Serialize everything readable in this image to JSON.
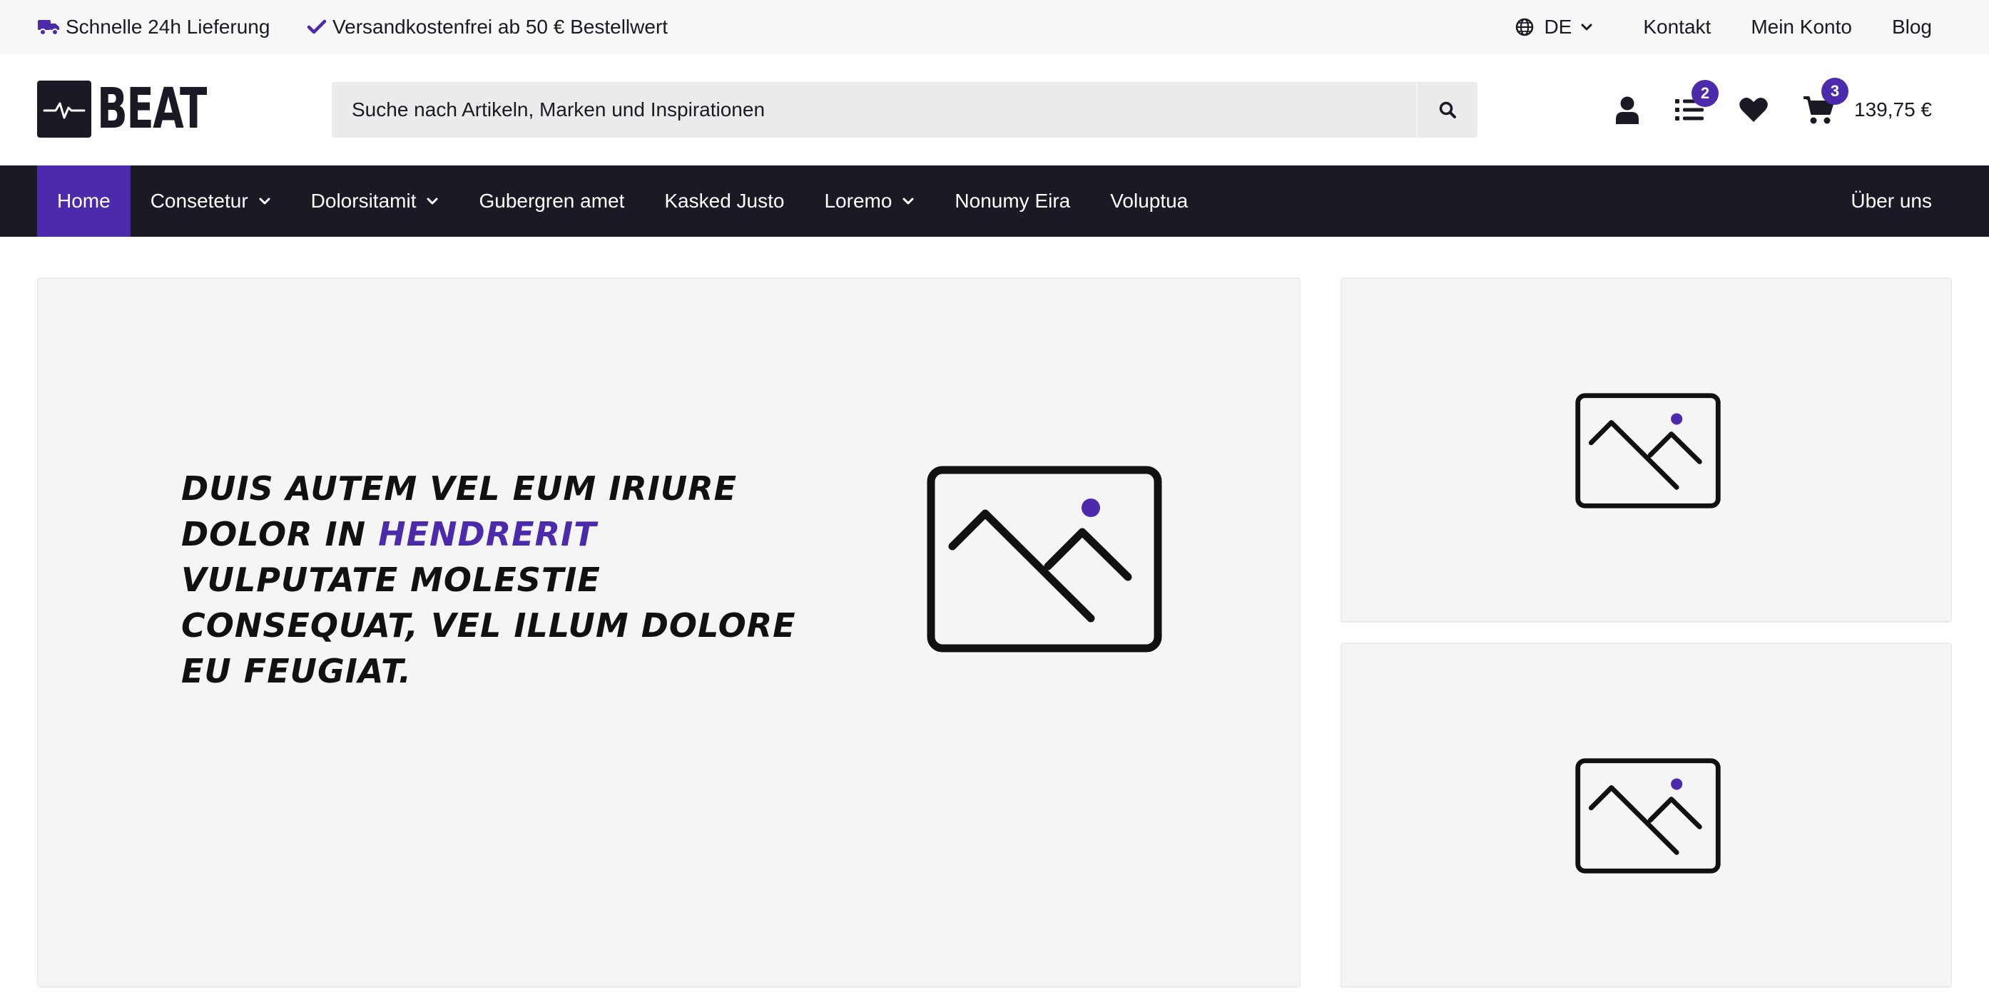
{
  "topbar": {
    "usp_delivery": "Schnelle 24h Lieferung",
    "usp_shipping": "Versandkostenfrei ab 50 € Bestellwert",
    "language": "DE",
    "links": [
      "Kontakt",
      "Mein Konto",
      "Blog"
    ]
  },
  "header": {
    "logo_text": "BEAT",
    "search_placeholder": "Suche nach Artikeln, Marken und Inspirationen",
    "list_badge": "2",
    "cart_badge": "3",
    "cart_total": "139,75 €"
  },
  "nav": {
    "items": [
      {
        "label": "Home",
        "has_dropdown": false,
        "active": true
      },
      {
        "label": "Consetetur",
        "has_dropdown": true
      },
      {
        "label": "Dolorsitamit",
        "has_dropdown": true
      },
      {
        "label": "Gubergren amet",
        "has_dropdown": false
      },
      {
        "label": "Kasked Justo",
        "has_dropdown": false
      },
      {
        "label": "Loremo",
        "has_dropdown": true
      },
      {
        "label": "Nonumy Eira",
        "has_dropdown": false
      },
      {
        "label": "Voluptua",
        "has_dropdown": false
      }
    ],
    "about": "Über uns"
  },
  "hero": {
    "text_before": "Duis autem vel eum iriure dolor in ",
    "text_highlight": "hendrerit",
    "text_after": " vulputate molestie consequat, vel illum dolore eu feugiat."
  },
  "colors": {
    "accent": "#4b2bab",
    "dark": "#1a1a24",
    "topbar_bg": "#f7f7f7",
    "panel_bg": "#f5f5f5"
  },
  "icons": {
    "delivery": "truck-icon",
    "shipping": "check-icon",
    "language": "globe-icon",
    "search": "search-icon",
    "account": "user-icon",
    "list": "list-icon",
    "wishlist": "heart-icon",
    "cart": "cart-icon",
    "placeholder": "image-placeholder-icon"
  }
}
